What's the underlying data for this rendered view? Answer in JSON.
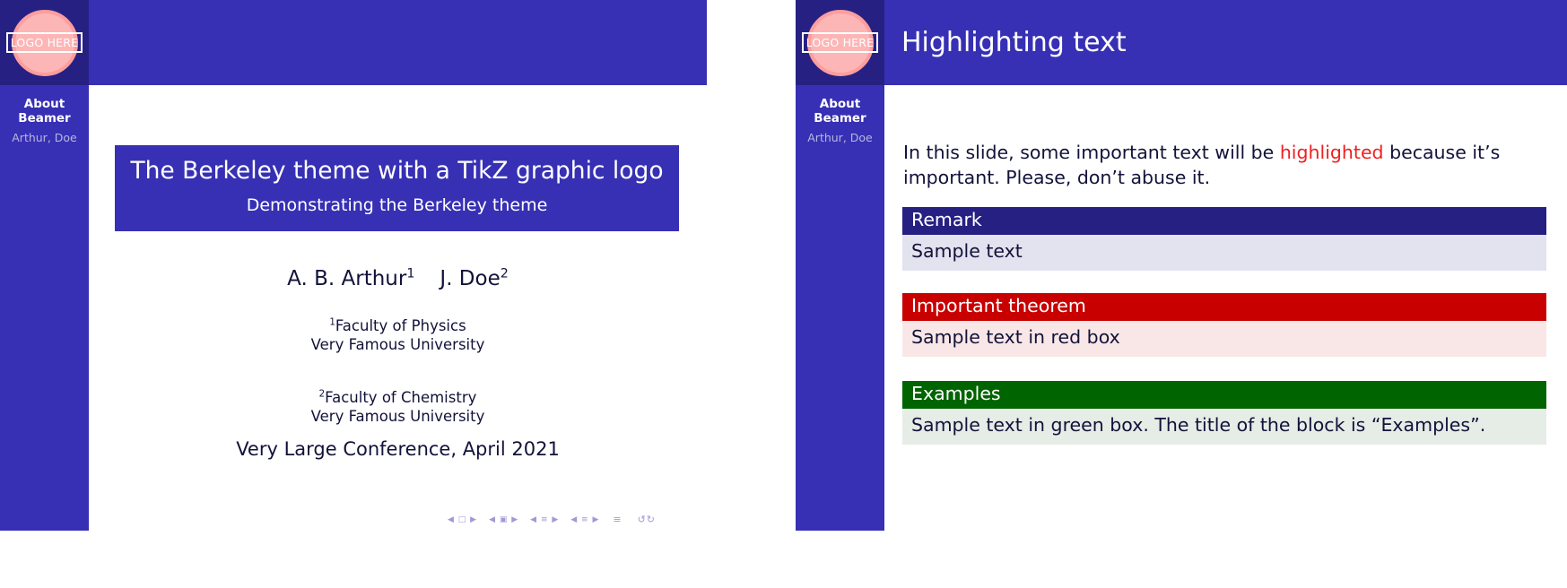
{
  "logo": {
    "label": "LOGO HERE",
    "circle_color": "#fdb6b6",
    "ring_color": "#fd9d9d"
  },
  "theme": {
    "primary": "#3730b4",
    "dark": "#262083",
    "alert": "#c80000",
    "example": "#006400",
    "highlight": "#ee2020"
  },
  "sidebar": {
    "section": "About Beamer",
    "authors_short": "Arthur, Doe"
  },
  "slide1": {
    "title": "The Berkeley theme with a TikZ graphic logo",
    "subtitle": "Demonstrating the Berkeley theme",
    "authors": [
      {
        "name": "A. B. Arthur",
        "marker": "1"
      },
      {
        "name": "J. Doe",
        "marker": "2"
      }
    ],
    "affiliations": [
      {
        "marker": "1",
        "dept": "Faculty of Physics",
        "institution": "Very Famous University"
      },
      {
        "marker": "2",
        "dept": "Faculty of Chemistry",
        "institution": "Very Famous University"
      }
    ],
    "conference": "Very Large Conference, April 2021"
  },
  "slide2": {
    "frame_title": "Highlighting text",
    "paragraph": {
      "before": "In this slide, some important text will be ",
      "highlighted": "highlighted",
      "after": " because it’s important. Please, don’t abuse it."
    },
    "blocks": [
      {
        "title": "Remark",
        "body": "Sample text"
      },
      {
        "title": "Important theorem",
        "body": "Sample text in red box"
      },
      {
        "title": "Examples",
        "body": "Sample text in green box. The title of the block is “Examples”."
      }
    ]
  },
  "navigation": {
    "first_slide": "◀ □ ▶",
    "prev_frame": "◀ ▣ ▶",
    "prev_subsection": "◀ ≡ ▶",
    "prev_slide": "◀ ≡ ▶",
    "current": "≡",
    "zoom": "↺↻"
  }
}
